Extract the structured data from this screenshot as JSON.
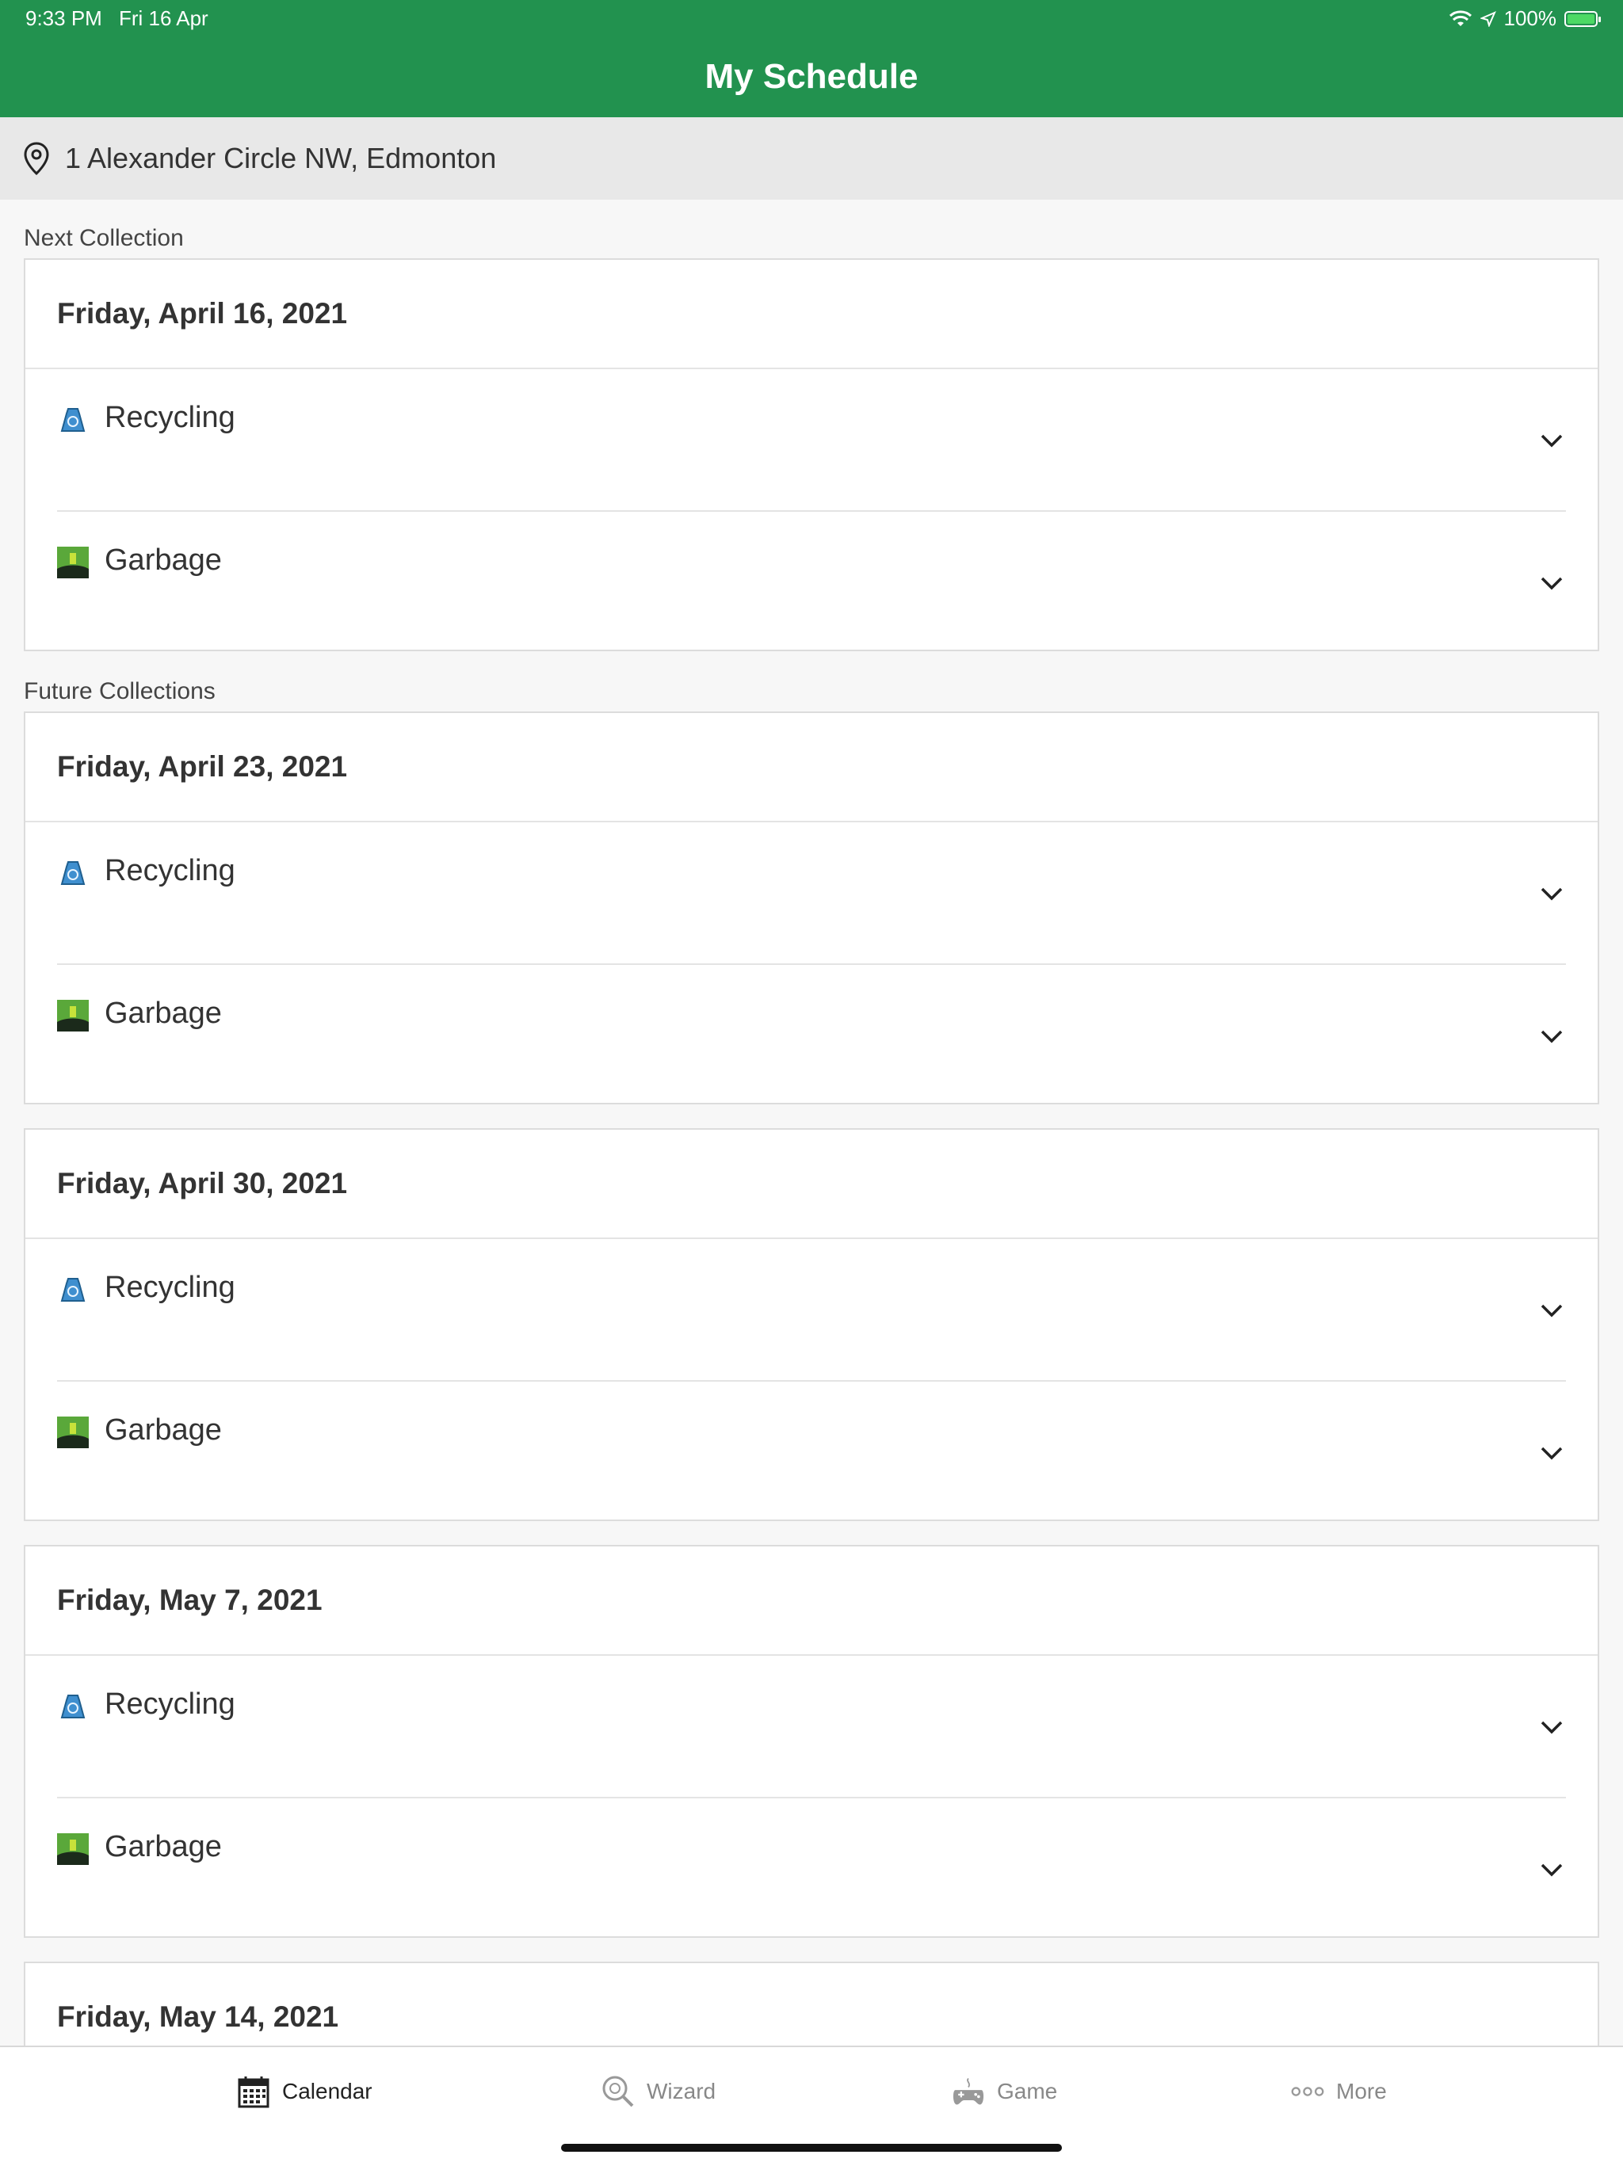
{
  "status_bar": {
    "time": "9:33 PM",
    "date": "Fri 16 Apr",
    "battery": "100%"
  },
  "header": {
    "title": "My Schedule"
  },
  "address": {
    "text": "1 Alexander Circle NW, Edmonton"
  },
  "next_collection": {
    "label": "Next Collection",
    "date": "Friday, April 16, 2021",
    "items": [
      {
        "label": "Recycling",
        "icon": "recycling-bag-icon"
      },
      {
        "label": "Garbage",
        "icon": "garbage-icon"
      }
    ]
  },
  "future_collections": {
    "label": "Future Collections",
    "cards": [
      {
        "date": "Friday, April 23, 2021",
        "items": [
          {
            "label": "Recycling"
          },
          {
            "label": "Garbage"
          }
        ]
      },
      {
        "date": "Friday, April 30, 2021",
        "items": [
          {
            "label": "Recycling"
          },
          {
            "label": "Garbage"
          }
        ]
      },
      {
        "date": "Friday, May 7, 2021",
        "items": [
          {
            "label": "Recycling"
          },
          {
            "label": "Garbage"
          }
        ]
      },
      {
        "date": "Friday, May 14, 2021",
        "items": []
      }
    ]
  },
  "tabbar": {
    "tabs": [
      {
        "label": "Calendar",
        "icon": "calendar-icon",
        "active": true
      },
      {
        "label": "Wizard",
        "icon": "wizard-icon",
        "active": false
      },
      {
        "label": "Game",
        "icon": "game-icon",
        "active": false
      },
      {
        "label": "More",
        "icon": "more-icon",
        "active": false
      }
    ]
  },
  "colors": {
    "brand": "#22924f",
    "recycling": "#2f7fc1",
    "garbage": "#3c8a3c"
  }
}
